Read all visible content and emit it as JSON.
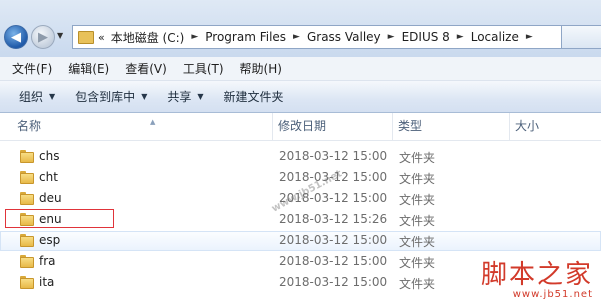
{
  "address_bar": {
    "overflow_chevron": "«",
    "crumbs": [
      "本地磁盘 (C:)",
      "Program Files",
      "Grass Valley",
      "EDIUS 8",
      "Localize"
    ],
    "separator": "►"
  },
  "menu": {
    "items": [
      "文件(F)",
      "编辑(E)",
      "查看(V)",
      "工具(T)",
      "帮助(H)"
    ]
  },
  "toolbar": {
    "organize": "组织",
    "include_in_library": "包含到库中",
    "share": "共享",
    "new_folder": "新建文件夹"
  },
  "columns": {
    "name": "名称",
    "date_modified": "修改日期",
    "type": "类型",
    "size": "大小"
  },
  "files": [
    {
      "name": "chs",
      "date": "2018-03-12 15:00",
      "type": "文件夹"
    },
    {
      "name": "cht",
      "date": "2018-03-12 15:00",
      "type": "文件夹"
    },
    {
      "name": "deu",
      "date": "2018-03-12 15:00",
      "type": "文件夹"
    },
    {
      "name": "enu",
      "date": "2018-03-12 15:26",
      "type": "文件夹"
    },
    {
      "name": "esp",
      "date": "2018-03-12 15:00",
      "type": "文件夹"
    },
    {
      "name": "fra",
      "date": "2018-03-12 15:00",
      "type": "文件夹"
    },
    {
      "name": "ita",
      "date": "2018-03-12 15:00",
      "type": "文件夹"
    }
  ],
  "watermark": "www.jb51.net",
  "logo": {
    "text": "脚本之家",
    "url": "www.jb51.net"
  },
  "colors": {
    "highlight_border": "#e0343a",
    "logo": "#d23a2a"
  }
}
